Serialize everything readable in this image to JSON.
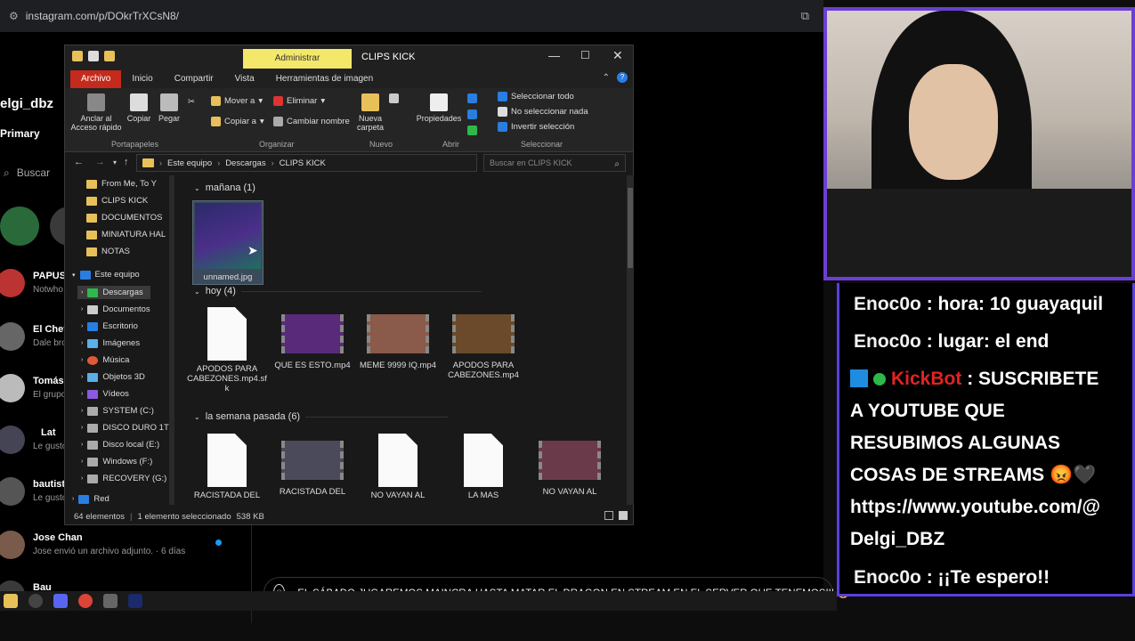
{
  "browser": {
    "url": "instagram.com/p/DOkrTrXCsN8/"
  },
  "instagram": {
    "username": "elgi_dbz",
    "tab_primary": "Primary",
    "search_placeholder": "Buscar",
    "dms": [
      {
        "name": "PAPUS",
        "sub": "Notwho"
      },
      {
        "name": "El Chef",
        "sub": "Dale bro"
      },
      {
        "name": "Tomás",
        "sub": "El grupo"
      },
      {
        "name": "Lat",
        "sub": "Le gusto"
      },
      {
        "name": "bautist",
        "sub": "Le gusto"
      },
      {
        "name": "Jose Chan",
        "sub": "Jose envió un archivo adjunto. · 6 días"
      },
      {
        "name": "Bau",
        "sub": ""
      }
    ],
    "message": "EL SÁBADO JUGAREMOS MAINCRA HASTA MATAR EL DRAGON EN STREAM EN EL SERVER QUE TENEMOS!!! 😲"
  },
  "explorer": {
    "manage_tab": "Administrar",
    "title": "CLIPS KICK",
    "tabs": [
      "Archivo",
      "Inicio",
      "Compartir",
      "Vista",
      "Herramientas de imagen"
    ],
    "ribbon": {
      "pin": "Anclar al Acceso rápido",
      "copy": "Copiar",
      "paste": "Pegar",
      "move_to": "Mover a",
      "copy_to": "Copiar a",
      "delete": "Eliminar",
      "rename": "Cambiar nombre",
      "new_folder": "Nueva carpeta",
      "properties": "Propiedades",
      "select_all": "Seleccionar todo",
      "select_none": "No seleccionar nada",
      "invert_selection": "Invertir selección",
      "group_clipboard": "Portapapeles",
      "group_organize": "Organizar",
      "group_new": "Nuevo",
      "group_open": "Abrir",
      "group_select": "Seleccionar"
    },
    "breadcrumb": [
      "Este equipo",
      "Descargas",
      "CLIPS KICK"
    ],
    "search_placeholder": "Buscar en CLIPS KICK",
    "nav": [
      "From Me, To Y",
      "CLIPS KICK",
      "DOCUMENTOS",
      "MINIATURA HAL",
      "NOTAS",
      "Este equipo",
      "Descargas",
      "Documentos",
      "Escritorio",
      "Imágenes",
      "Música",
      "Objetos 3D",
      "Vídeos",
      "SYSTEM (C:)",
      "DISCO DURO 1TE",
      "Disco local (E:)",
      "Windows (F:)",
      "RECOVERY (G:)",
      "Red"
    ],
    "groups": {
      "tomorrow": "mañana (1)",
      "today": "hoy (4)",
      "last_week": "la semana pasada (6)"
    },
    "files_tomorrow": [
      {
        "name": "unnamed.jpg"
      }
    ],
    "files_today": [
      {
        "name": "APODOS PARA CABEZONES.mp4.sfk"
      },
      {
        "name": "QUE ES ESTO.mp4"
      },
      {
        "name": "MEME 9999 IQ.mp4"
      },
      {
        "name": "APODOS PARA CABEZONES.mp4"
      }
    ],
    "files_last_week": [
      {
        "name": "RACISTADA DEL"
      },
      {
        "name": "RACISTADA DEL"
      },
      {
        "name": "NO VAYAN AL"
      },
      {
        "name": "LA MAS"
      },
      {
        "name": "NO VAYAN AL"
      }
    ],
    "status": {
      "count": "64 elementos",
      "selected": "1 elemento seleccionado",
      "size": "538 KB"
    }
  },
  "chat": {
    "messages": [
      {
        "user": "Enoc0o",
        "text": ": hora: 10 guayaquil"
      },
      {
        "user": "Enoc0o",
        "text": ": lugar: el end"
      },
      {
        "user": "KickBot",
        "text": ": SUSCRIBETE"
      },
      {
        "user": "",
        "text": "A YOUTUBE QUE"
      },
      {
        "user": "",
        "text": "RESUBIMOS ALGUNAS"
      },
      {
        "user": "",
        "text": "COSAS DE STREAMS 😡🖤"
      },
      {
        "user": "",
        "text": "https://www.youtube.com/@"
      },
      {
        "user": "",
        "text": "Delgi_DBZ"
      },
      {
        "user": "Enoc0o",
        "text": ": ¡¡Te espero!!"
      }
    ]
  },
  "colors": {
    "webcam_border": "#6b3fd4",
    "chat_border": "#5b3fe0",
    "kickbot": "#e02424",
    "archivo_tab": "#c42b1c",
    "manage_tab": "#f3e86a"
  }
}
